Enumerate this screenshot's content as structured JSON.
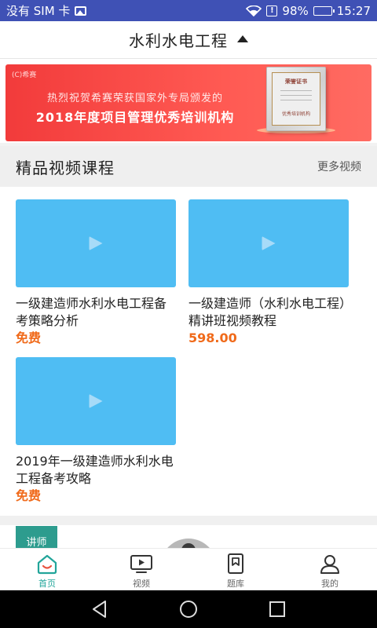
{
  "status_bar": {
    "carrier": "没有 SIM 卡",
    "battery": "98%",
    "time": "15:27"
  },
  "header": {
    "title": "水利水电工程"
  },
  "banner": {
    "logo": "(C)希赛",
    "line1": "热烈祝贺希赛荣获国家外专局颁发的",
    "line2": "2018年度项目管理优秀培训机构",
    "cert_title": "荣誉证书",
    "cert_sub": "优秀培训机构"
  },
  "section": {
    "title": "精品视频课程",
    "more": "更多视频"
  },
  "courses": [
    {
      "title": "一级建造师水利水电工程备考策略分析",
      "price": "免费"
    },
    {
      "title": "一级建造师（水利水电工程）精讲班视频教程",
      "price": "598.00"
    },
    {
      "title": "2019年一级建造师水利水电工程备考攻略",
      "price": "免费"
    }
  ],
  "teacher": {
    "tag": "讲师"
  },
  "bottom_nav": [
    {
      "label": "首页",
      "icon": "home-icon",
      "active": true
    },
    {
      "label": "视频",
      "icon": "video-icon",
      "active": false
    },
    {
      "label": "题库",
      "icon": "question-bank-icon",
      "active": false
    },
    {
      "label": "我的",
      "icon": "profile-icon",
      "active": false
    }
  ],
  "colors": {
    "status_bar": "#3f51b5",
    "accent": "#22a59a",
    "price": "#f06a1a",
    "thumb": "#4fbdf3",
    "banner": "#f23b3b"
  }
}
